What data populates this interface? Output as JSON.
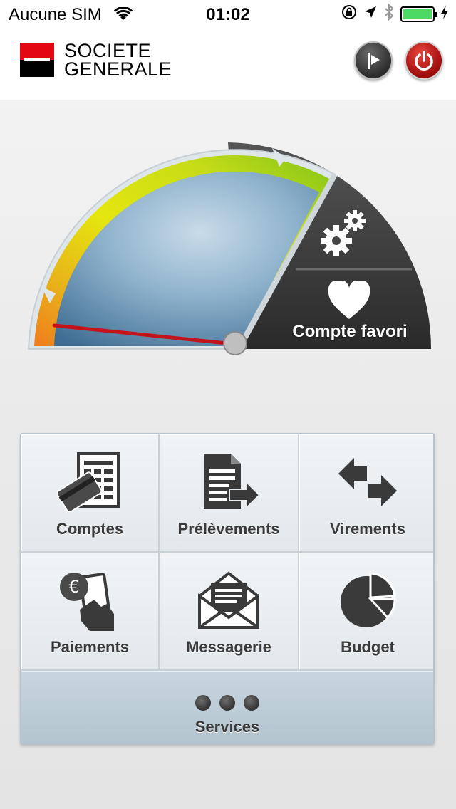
{
  "status_bar": {
    "carrier": "Aucune SIM",
    "time": "01:02",
    "icons": [
      "wifi-icon",
      "orientation-lock-icon",
      "location-icon",
      "bluetooth-icon",
      "battery-icon",
      "charging-icon"
    ]
  },
  "header": {
    "brand_line1": "SOCIETE",
    "brand_line2": "GENERALE",
    "flag_button_icon": "flag-play-icon",
    "power_button_icon": "power-icon"
  },
  "gauge": {
    "settings_icon": "gears-icon",
    "favorite_icon": "heart-icon",
    "favorite_label": "Compte favori",
    "colors": {
      "orange": "#f07c1c",
      "yellow": "#e5e60f",
      "green": "#7fc41a",
      "needle": "#c4131b",
      "dial": "#5f8fb3",
      "dark_panel": "#3a3a3a"
    }
  },
  "menu": {
    "items": [
      {
        "label": "Comptes",
        "icon": "accounts-icon"
      },
      {
        "label": "Prélèvements",
        "icon": "direct-debit-icon"
      },
      {
        "label": "Virements",
        "icon": "transfer-arrows-icon"
      },
      {
        "label": "Paiements",
        "icon": "payment-euro-icon"
      },
      {
        "label": "Messagerie",
        "icon": "envelope-icon"
      },
      {
        "label": "Budget",
        "icon": "pie-chart-icon"
      }
    ],
    "services_label": "Services",
    "services_icon": "more-dots-icon"
  }
}
